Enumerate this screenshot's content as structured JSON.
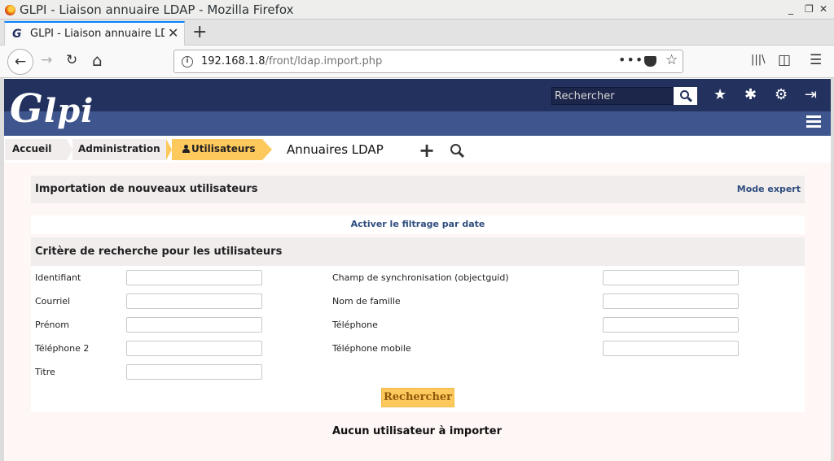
{
  "window": {
    "title": "GLPI - Liaison annuaire LDAP - Mozilla Firefox",
    "minimize": "_",
    "restore": "❐",
    "close": "✕"
  },
  "tabs": [
    {
      "favicon": "G",
      "title": "GLPI - Liaison annuaire LDAP",
      "close": "✕"
    }
  ],
  "new_tab": "+",
  "nav": {
    "back": "←",
    "forward": "→",
    "reload": "↻",
    "home": "⌂",
    "url_host": "192.168.1.8",
    "url_path": "/front/ldap.import.php",
    "more": "•••",
    "star": "☆",
    "library": "|||\\",
    "sidebar": "◫",
    "menu": "☰"
  },
  "header": {
    "logo_g": "G",
    "logo_rest": "lpi",
    "search_placeholder": "Rechercher",
    "icons": {
      "star": "★",
      "bug": "✱",
      "gear": "⚙",
      "logout": "⇥"
    }
  },
  "breadcrumb": [
    {
      "label": "Accueil"
    },
    {
      "label": "Administration"
    },
    {
      "label": "Utilisateurs"
    }
  ],
  "page_heading": "Annuaires LDAP",
  "plus": "+",
  "import_panel": {
    "title": "Importation de nouveaux utilisateurs",
    "expert_link": "Mode expert",
    "date_filter_link": "Activer le filtrage par date"
  },
  "criteria": {
    "title": "Critère de recherche pour les utilisateurs",
    "left_fields": [
      {
        "label": "Identifiant",
        "value": ""
      },
      {
        "label": "Courriel",
        "value": ""
      },
      {
        "label": "Prénom",
        "value": ""
      },
      {
        "label": "Téléphone 2",
        "value": ""
      },
      {
        "label": "Titre",
        "value": ""
      }
    ],
    "right_fields": [
      {
        "label": "Champ de synchronisation (objectguid)",
        "value": ""
      },
      {
        "label": "Nom de famille",
        "value": ""
      },
      {
        "label": "Téléphone",
        "value": ""
      },
      {
        "label": "Téléphone mobile",
        "value": ""
      }
    ],
    "submit_label": "Rechercher"
  },
  "result_message": "Aucun utilisateur à importer",
  "colors": {
    "header_dark": "#23315e",
    "header_mid": "#3e558d",
    "accent_yellow": "#fec95c",
    "link_blue": "#2f4d7e",
    "panel_grey": "#f1eded",
    "page_bg": "#fff6f6"
  }
}
